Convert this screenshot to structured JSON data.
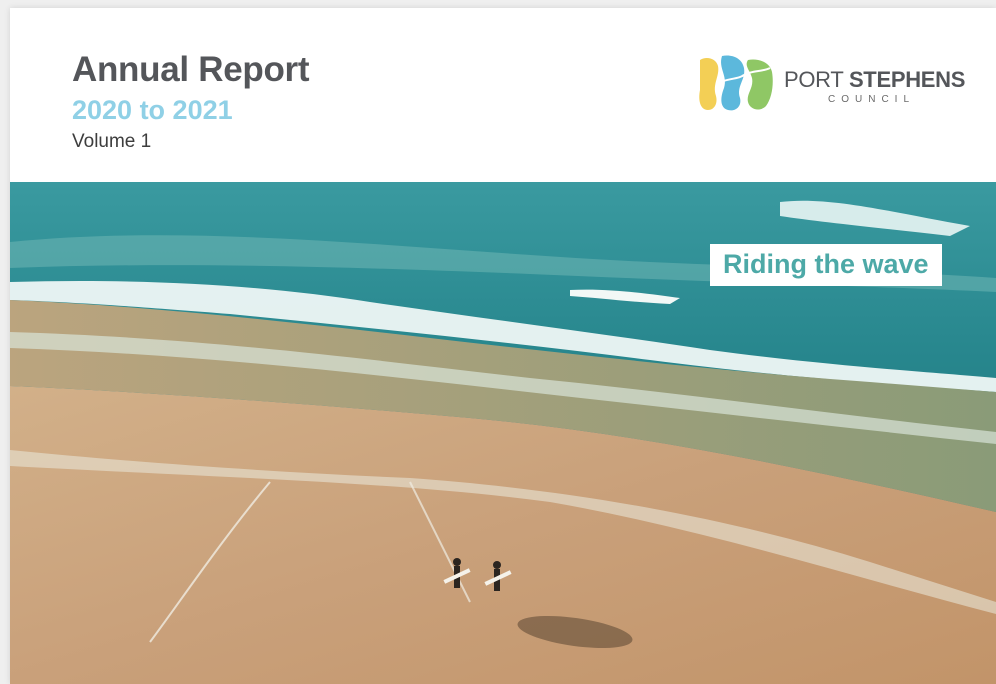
{
  "report": {
    "title": "Annual Report",
    "subtitle": "2020 to 2021",
    "volume": "Volume 1"
  },
  "logo": {
    "name_regular": "PORT ",
    "name_bold": "STEPHENS",
    "sub": "COUNCIL",
    "colors": {
      "yellow": "#f3cf55",
      "blue": "#5cb8dc",
      "green": "#8fc765"
    },
    "icon": "port-stephens-wave-logo"
  },
  "tagline": "Riding the wave",
  "colors": {
    "title": "#54565a",
    "subtitle": "#8fd0e6",
    "tagline": "#4da9a7",
    "sea": "#1f7f87",
    "sand": "#caa27d"
  }
}
